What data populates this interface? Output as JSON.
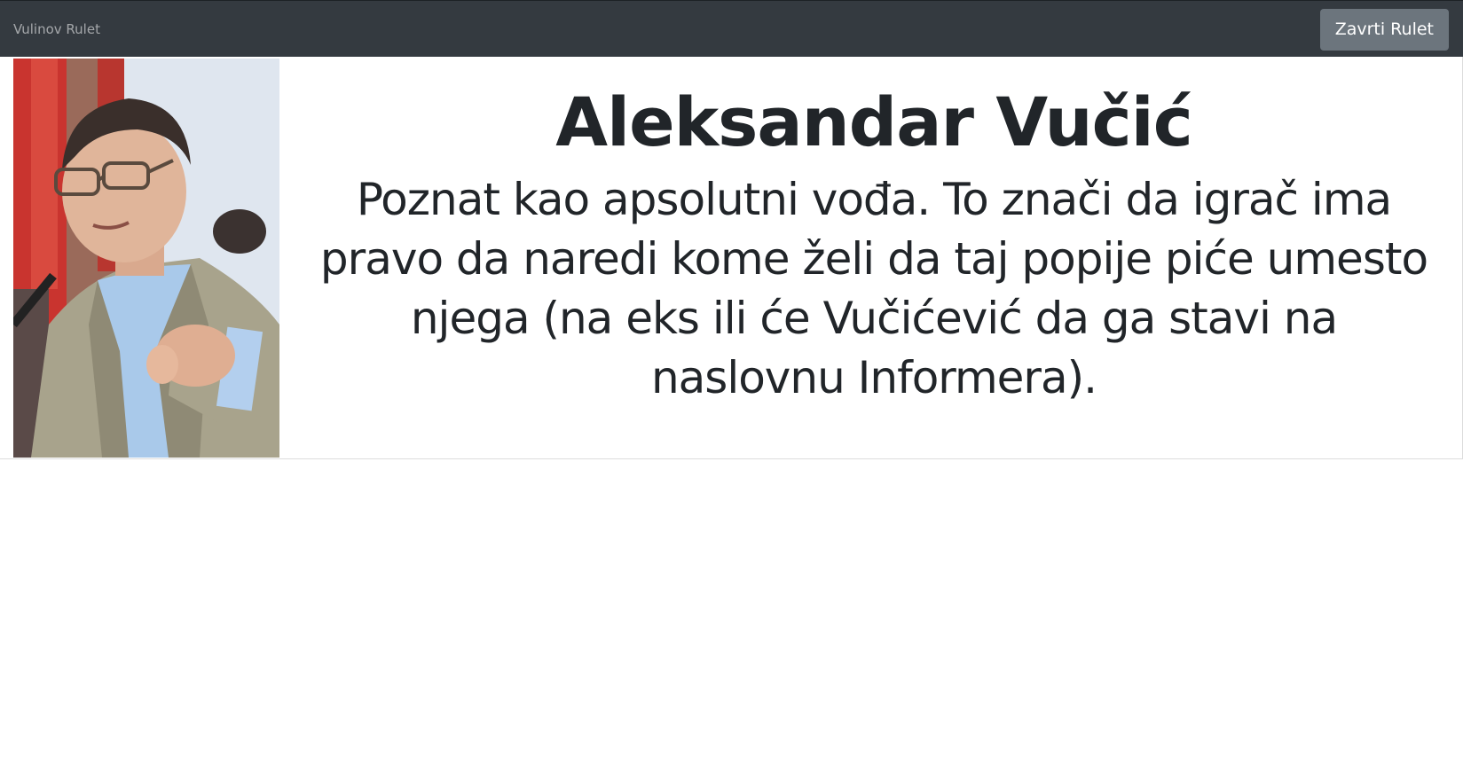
{
  "navbar": {
    "brand": "Vulinov Rulet",
    "spin_button_label": "Zavrti Rulet"
  },
  "card": {
    "image_alt": "portrait-photo",
    "title": "Aleksandar Vučić",
    "description": "Poznat kao apsolutni vođa. To znači da igrač ima pravo da naredi kome želi da taj popije piće umesto njega (na eks ili će Vučićević da ga stavi na naslovnu Informera)."
  },
  "colors": {
    "navbar_bg": "#343a40",
    "button_bg": "#6c757d",
    "text": "#212529"
  }
}
